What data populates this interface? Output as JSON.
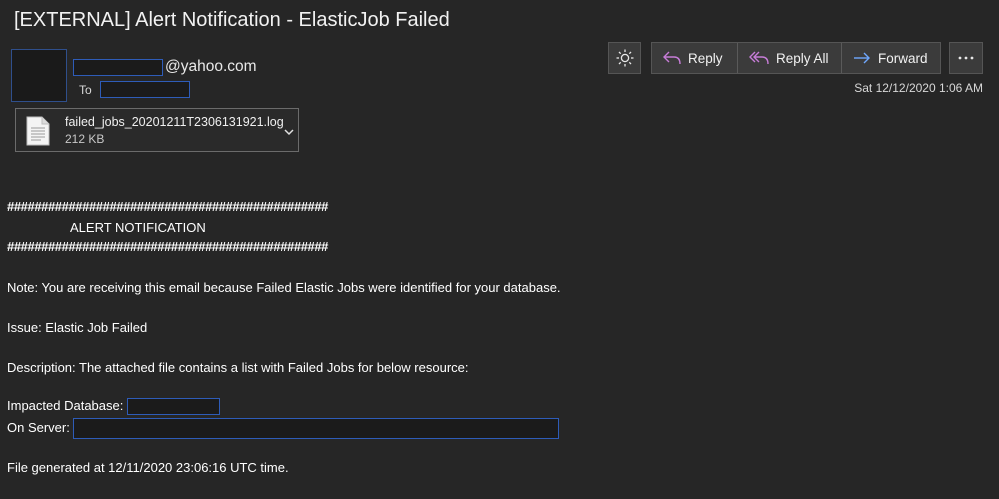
{
  "email": {
    "subject": "[EXTERNAL] Alert Notification - ElasticJob Failed",
    "from_domain": "@yahoo.com",
    "to_label": "To",
    "date": "Sat 12/12/2020 1:06 AM"
  },
  "attachment": {
    "filename": "failed_jobs_20201211T2306131921.log",
    "size": "212 KB"
  },
  "toolbar": {
    "reply_label": "Reply",
    "reply_all_label": "Reply All",
    "forward_label": "Forward",
    "more_label": "···"
  },
  "body": {
    "hash_line_1": "###############################################",
    "alert_title": "ALERT NOTIFICATION",
    "hash_line_2": "###############################################",
    "note": "Note: You are receiving this email because Failed Elastic Jobs were identified for your database.",
    "issue": "Issue: Elastic Job Failed",
    "description": "Description: The attached file contains a list with Failed Jobs for below resource:",
    "impacted_db_label": "Impacted Database:",
    "server_label": "On Server:",
    "generated": "File generated at 12/11/2020 23:06:16 UTC time."
  },
  "colors": {
    "background": "#262626",
    "redaction_border": "#2e5cb8",
    "reply_icon": "#c77dd8",
    "forward_icon": "#6fa8ff"
  }
}
